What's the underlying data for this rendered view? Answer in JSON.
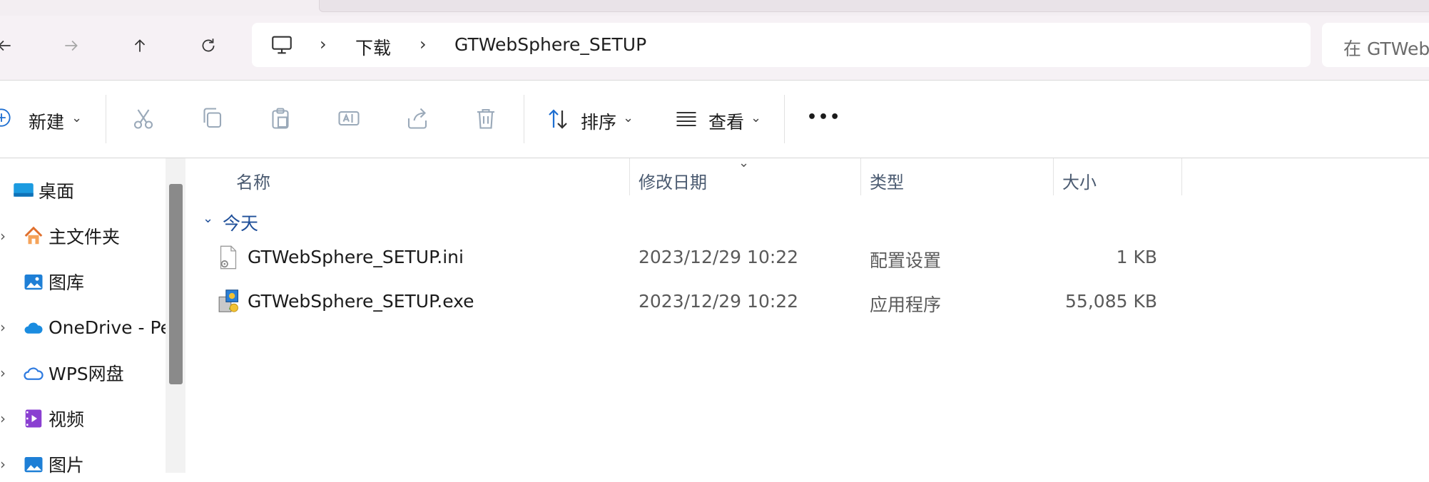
{
  "nav": {
    "back_icon": "arrow-left-icon",
    "forward_icon": "arrow-right-icon",
    "up_icon": "arrow-up-icon",
    "refresh_icon": "refresh-icon"
  },
  "breadcrumb": {
    "root_icon": "this-pc-icon",
    "items": [
      "下载",
      "GTWebSphere_SETUP"
    ]
  },
  "search": {
    "placeholder": "在 GTWeb"
  },
  "toolbar": {
    "new_label": "新建",
    "sort_label": "排序",
    "view_label": "查看",
    "more_label": "•••"
  },
  "sidebar": {
    "items": [
      {
        "label": "桌面",
        "icon": "desktop-icon"
      },
      {
        "label": "主文件夹",
        "icon": "home-icon"
      },
      {
        "label": "图库",
        "icon": "gallery-icon"
      },
      {
        "label": "OneDrive - Pe",
        "icon": "onedrive-icon"
      },
      {
        "label": "WPS网盘",
        "icon": "wps-cloud-icon"
      },
      {
        "label": "视频",
        "icon": "video-icon"
      },
      {
        "label": "图片",
        "icon": "pictures-icon"
      }
    ]
  },
  "columns": {
    "name": "名称",
    "date": "修改日期",
    "type": "类型",
    "size": "大小"
  },
  "group": {
    "label": "今天"
  },
  "files": [
    {
      "name": "GTWebSphere_SETUP.ini",
      "date": "2023/12/29 10:22",
      "type": "配置设置",
      "size": "1 KB",
      "icon": "settings-file-icon"
    },
    {
      "name": "GTWebSphere_SETUP.exe",
      "date": "2023/12/29 10:22",
      "type": "应用程序",
      "size": "55,085 KB",
      "icon": "installer-exe-icon"
    }
  ],
  "colors": {
    "accent": "#1f6fd1",
    "group_text": "#1f4f99",
    "header_text": "#4a5a70"
  }
}
